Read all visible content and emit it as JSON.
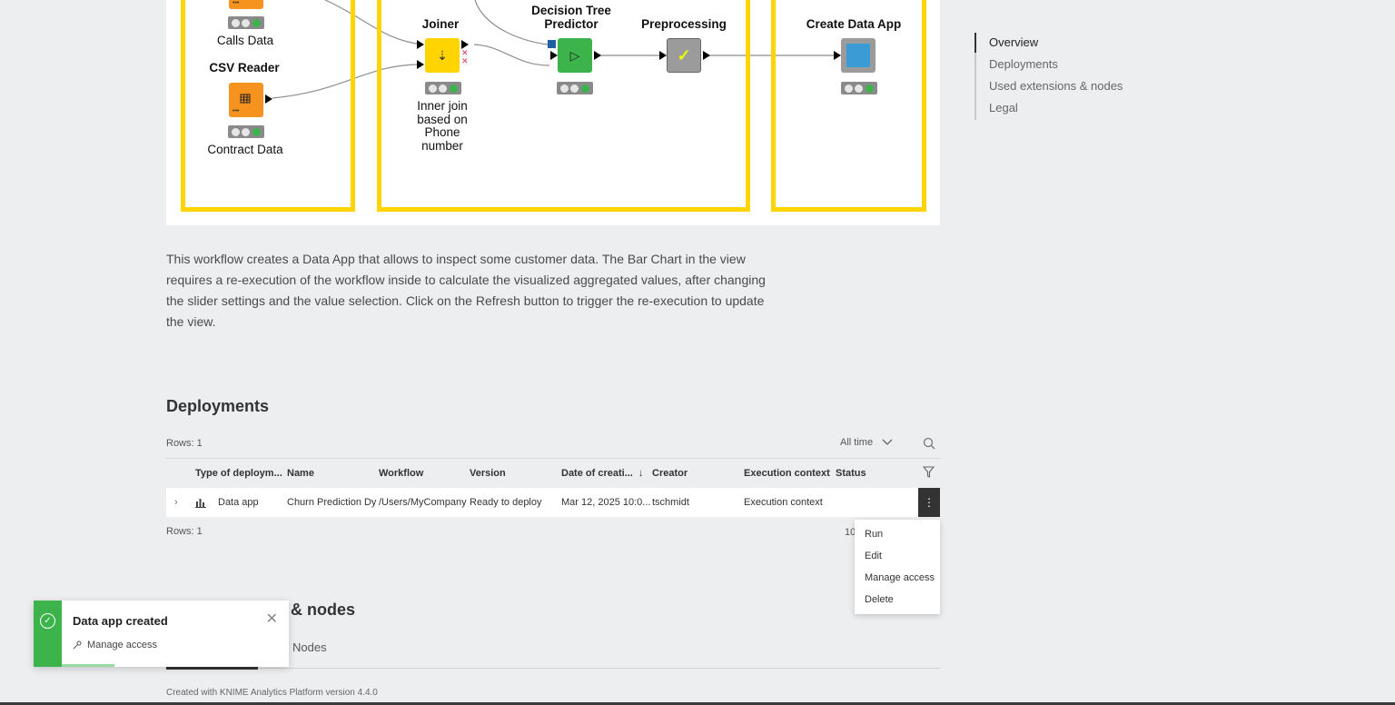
{
  "diagram": {
    "nodes": {
      "calls_reader": {
        "caption": "Calls Data"
      },
      "csv_reader": {
        "title": "CSV Reader",
        "caption": "Contract Data"
      },
      "joiner": {
        "title": "Joiner",
        "caption": "Inner join based on Phone number"
      },
      "decision_tree": {
        "title": "Decision Tree Predictor"
      },
      "preprocessing": {
        "title": "Preprocessing"
      },
      "data_app": {
        "title": "Create Data App"
      }
    }
  },
  "description": "This workflow creates a Data App that allows to inspect some customer data. The Bar Chart in the view requires a re-execution of the workflow inside to calculate the visualized aggregated values, after changing the slider settings and the value selection. Click on the Refresh button to trigger the re-execution to update the view.",
  "right_nav": {
    "items": [
      {
        "label": "Overview",
        "active": true
      },
      {
        "label": "Deployments",
        "active": false
      },
      {
        "label": "Used extensions & nodes",
        "active": false
      },
      {
        "label": "Legal",
        "active": false
      }
    ]
  },
  "deployments": {
    "heading": "Deployments",
    "rows_top": "Rows: 1",
    "rows_bottom": "Rows: 1",
    "filter_label": "All time",
    "page_size_partial": "10",
    "columns": [
      "Type of deploym...",
      "Name",
      "Workflow",
      "Version",
      "Date of creati...",
      "Creator",
      "Execution context",
      "Status"
    ],
    "rows": [
      {
        "type": "Data app",
        "name": "Churn Prediction Dy",
        "workflow": "/Users/MyCompany",
        "version": "Ready to deploy",
        "date": "Mar 12, 2025 10:0...",
        "creator": "tschmidt",
        "exec_context": "Execution context",
        "status": ""
      }
    ],
    "menu": [
      "Run",
      "Edit",
      "Manage access",
      "Delete"
    ]
  },
  "extensions": {
    "heading_partial": "& nodes",
    "tab_nodes": "Nodes"
  },
  "footer": "Created with KNIME Analytics Platform version 4.4.0",
  "toast": {
    "title": "Data app created",
    "link": "Manage access"
  },
  "colors": {
    "annotation": "#ffd400",
    "reader_node": "#f6921e",
    "manipulator_node": "#ffd400",
    "predictor_node": "#3cb44b",
    "metanode": "#9b9b9b",
    "view_node": "#3a9bd5",
    "success": "#3cb44b"
  }
}
